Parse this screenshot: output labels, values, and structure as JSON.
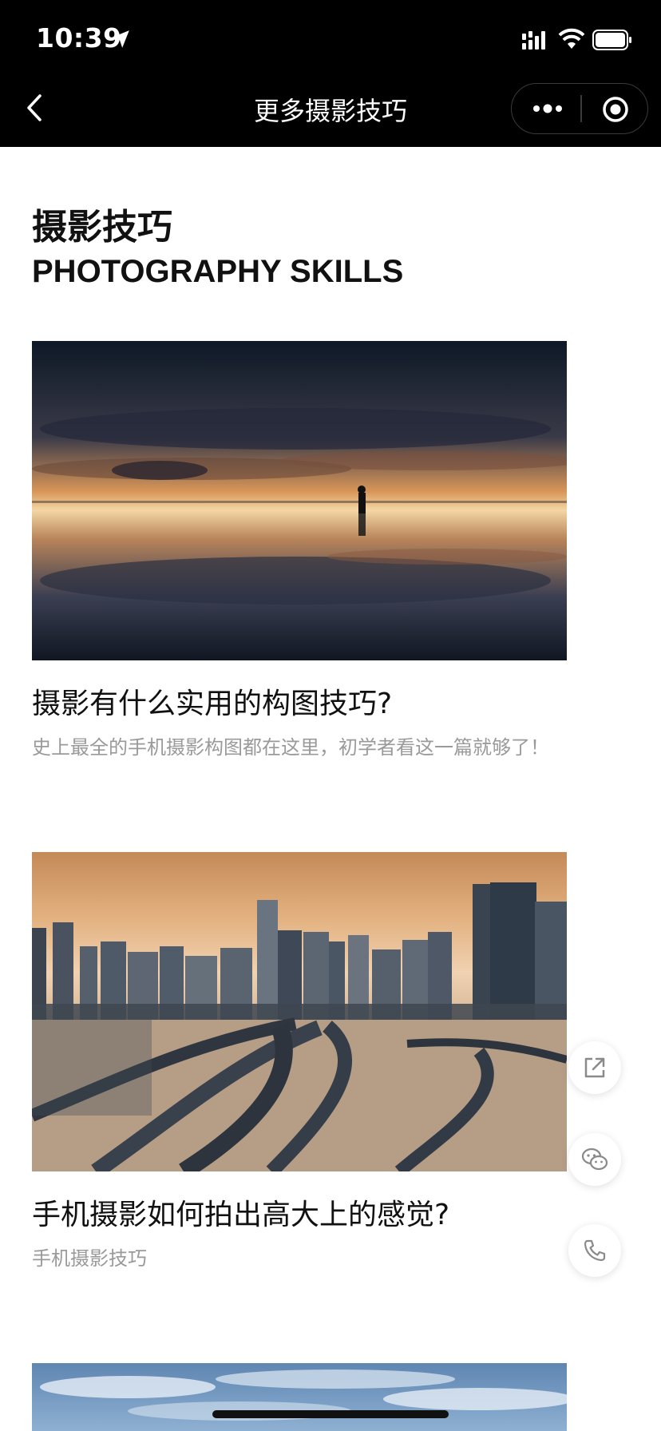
{
  "status_bar": {
    "time": "10:39"
  },
  "nav": {
    "title": "更多摄影技巧"
  },
  "header": {
    "title_cn": "摄影技巧",
    "title_en": "PHOTOGRAPHY SKILLS"
  },
  "articles": [
    {
      "title": "摄影有什么实用的构图技巧?",
      "subtitle": "史上最全的手机摄影构图都在这里，初学者看这一篇就够了！"
    },
    {
      "title": "手机摄影如何拍出高大上的感觉?",
      "subtitle": "手机摄影技巧"
    },
    {
      "title": "",
      "subtitle": ""
    }
  ],
  "floating_actions": [
    {
      "icon": "share-icon"
    },
    {
      "icon": "wechat-icon"
    },
    {
      "icon": "phone-icon"
    }
  ]
}
